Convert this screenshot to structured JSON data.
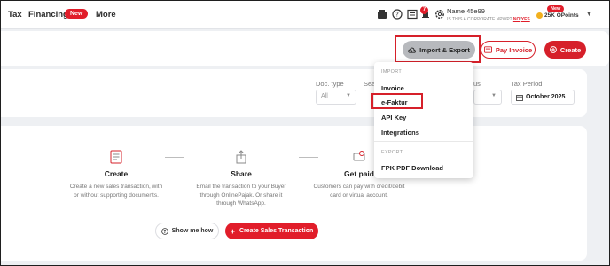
{
  "nav": {
    "items": [
      {
        "label": "Tax"
      },
      {
        "label": "Financing",
        "badge": "New"
      },
      {
        "label": "More"
      }
    ],
    "notification_count": "7",
    "user": {
      "name": "Name 45e99",
      "corporate_question": "IS THIS A CORPORATE NPWP?",
      "no": "NO",
      "separator": "/",
      "yes": "YES"
    },
    "points": {
      "badge": "New",
      "value": "25K OPoints"
    }
  },
  "toolbar": {
    "import_export_label": "Import & Export",
    "pay_invoice_label": "Pay Invoice",
    "create_label": "Create"
  },
  "filters": {
    "doc_type": {
      "label": "Doc. type",
      "value": "All"
    },
    "search_label": "Sea",
    "status_label": "us",
    "tax_period": {
      "label": "Tax Period",
      "value": "October 2025"
    }
  },
  "menu": {
    "import_heading": "IMPORT",
    "import_items": [
      "Invoice",
      "e-Faktur",
      "API Key",
      "Integrations"
    ],
    "export_heading": "EXPORT",
    "export_items": [
      "FPK PDF Download"
    ]
  },
  "onboarding": {
    "steps": [
      {
        "title": "Create",
        "desc": "Create a new sales transaction, with or without supporting documents."
      },
      {
        "title": "Share",
        "desc": "Email the transaction to your Buyer through OnlinePajak. Or share it through WhatsApp."
      },
      {
        "title": "Get paid",
        "desc": "Customers can pay with credit/debit card or virtual account."
      }
    ],
    "show_me_how_label": "Show me how",
    "create_sales_label": "Create Sales Transaction"
  },
  "colors": {
    "accent": "#e11d2a",
    "highlight_box": "#d6202a"
  }
}
